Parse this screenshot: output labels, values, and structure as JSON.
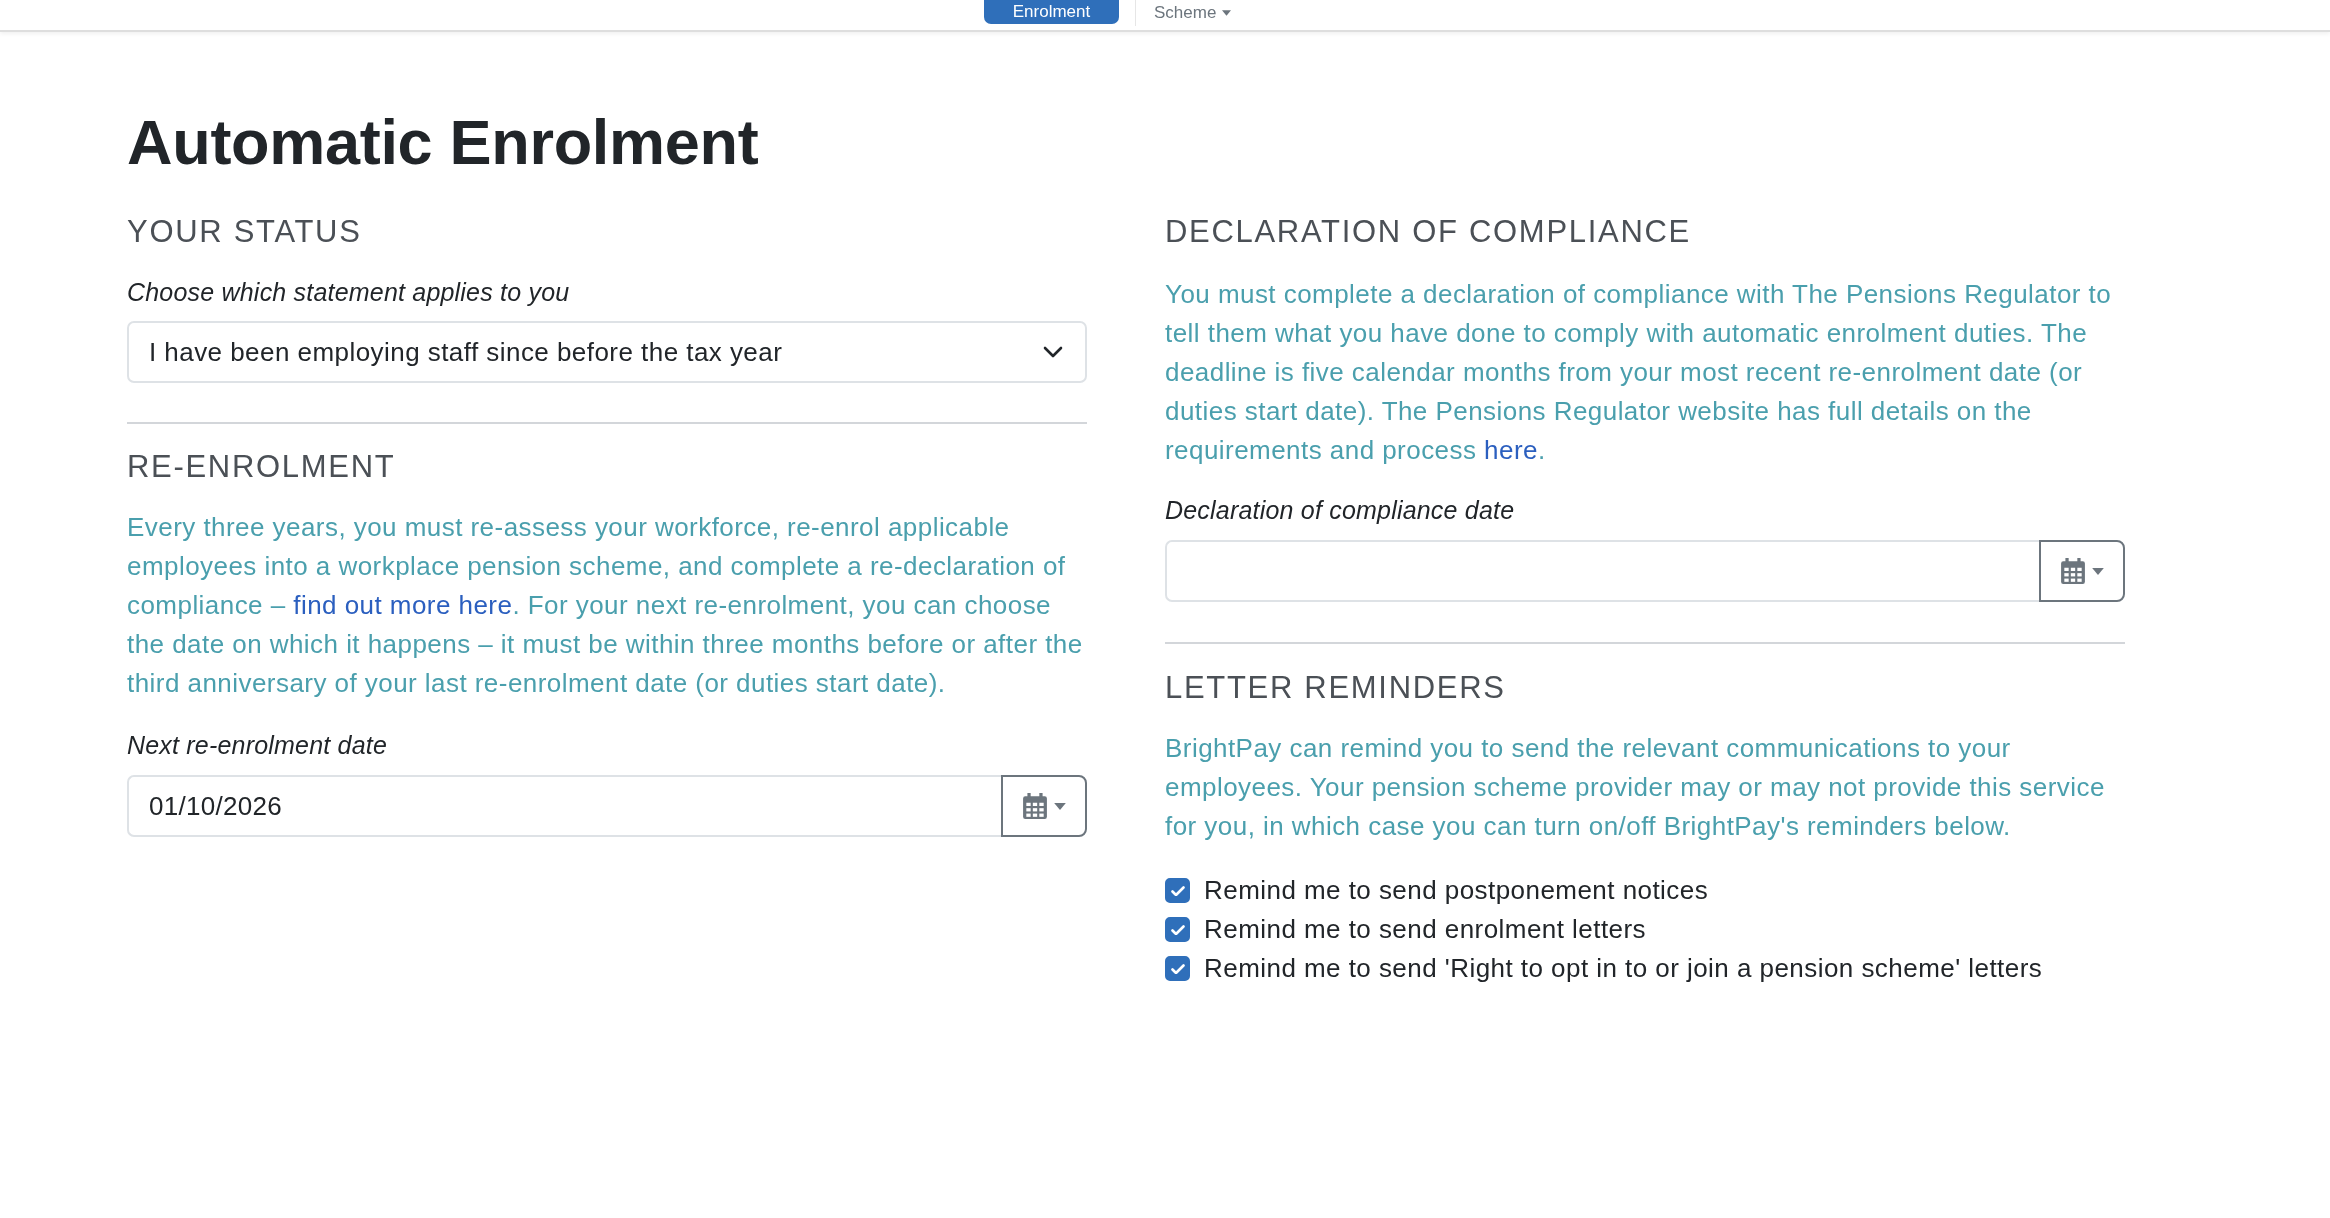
{
  "top_nav": {
    "tabs": [
      {
        "label": "Enrolment",
        "selected": true,
        "has_menu": false
      },
      {
        "label": "Scheme",
        "selected": false,
        "has_menu": true
      }
    ]
  },
  "page_title": "Automatic Enrolment",
  "your_status": {
    "heading": "YOUR STATUS",
    "field_label": "Choose which statement applies to you",
    "select_value": "I have been employing staff since before the tax year"
  },
  "re_enrolment": {
    "heading": "RE-ENROLMENT",
    "paragraph": [
      {
        "kind": "text",
        "text": "Every three years, you must re-assess your workforce, re-enrol applicable employees into a workplace pension scheme, and complete a re-declaration of compliance – "
      },
      {
        "kind": "link",
        "text": "find out more here"
      },
      {
        "kind": "text",
        "text": ". For your next re-enrolment, you can choose the date on which it happens – it must be within three months before or after the third anniversary of your last re-enrolment date (or duties start date)."
      }
    ],
    "field_label": "Next re-enrolment date",
    "date_value": "01/10/2026"
  },
  "declaration_of_compliance": {
    "heading": "DECLARATION OF COMPLIANCE",
    "paragraph": [
      {
        "kind": "text",
        "text": "You must complete a declaration of compliance with The Pensions Regulator to tell them what you have done to comply with automatic enrolment duties. The deadline is five calendar months from your most recent re-enrolment date (or duties start date). The Pensions Regulator website has full details on the requirements and process "
      },
      {
        "kind": "link",
        "text": "here"
      },
      {
        "kind": "text",
        "text": "."
      }
    ],
    "field_label": "Declaration of compliance date"
  },
  "letter_reminders": {
    "heading": "LETTER REMINDERS",
    "paragraph": "BrightPay can remind you to send the relevant communications to your employees. Your pension scheme provider may or may not provide this service for you, in which case you can turn on/off BrightPay's reminders below.",
    "options": [
      {
        "label": "Remind me to send postponement notices",
        "checked": true
      },
      {
        "label": "Remind me to send enrolment letters",
        "checked": true
      },
      {
        "label": "Remind me to send 'Right to opt in to or join a pension scheme' letters",
        "checked": true
      }
    ]
  }
}
